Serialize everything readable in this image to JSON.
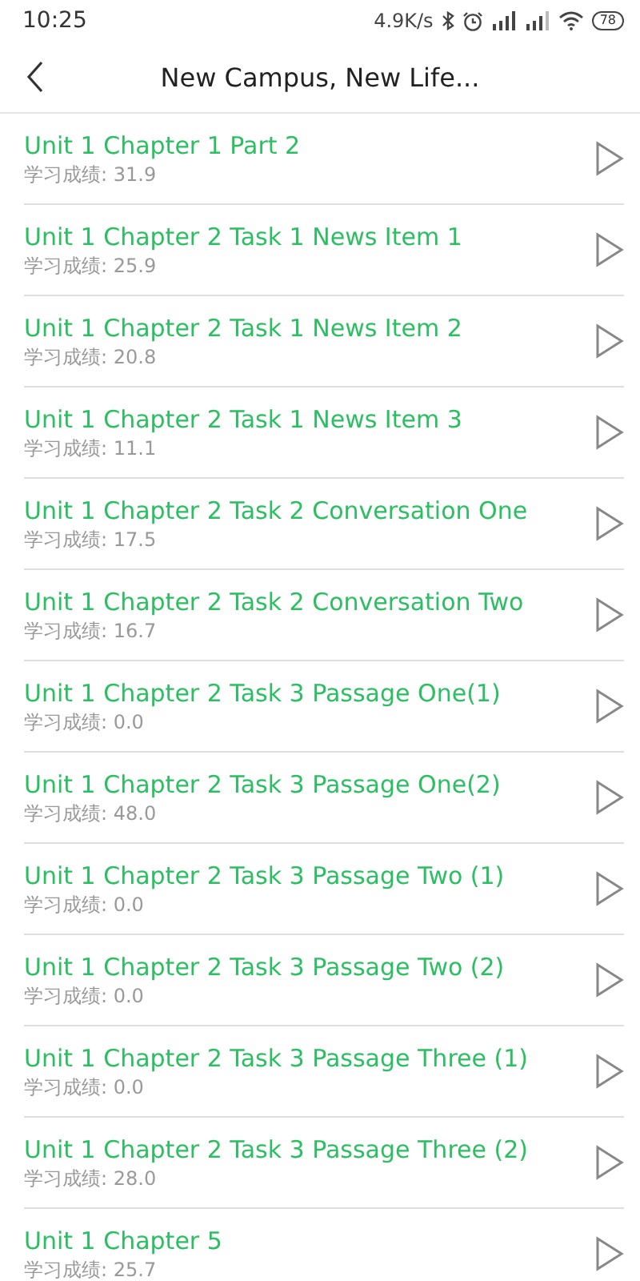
{
  "status_bar": {
    "time": "10:25",
    "speed": "4.9K/s",
    "battery": "78"
  },
  "header": {
    "title": "New Campus, New Life..."
  },
  "items": [
    {
      "title": "Unit 1 Chapter 1 Part 2",
      "score": "学习成绩: 31.9"
    },
    {
      "title": "Unit 1 Chapter 2 Task 1 News Item 1",
      "score": "学习成绩: 25.9"
    },
    {
      "title": "Unit 1 Chapter 2 Task 1 News Item 2",
      "score": "学习成绩: 20.8"
    },
    {
      "title": "Unit 1 Chapter 2 Task 1 News Item 3",
      "score": "学习成绩: 11.1"
    },
    {
      "title": "Unit 1 Chapter 2 Task 2 Conversation One",
      "score": "学习成绩: 17.5"
    },
    {
      "title": "Unit 1 Chapter 2 Task 2 Conversation Two",
      "score": "学习成绩: 16.7"
    },
    {
      "title": "Unit 1 Chapter 2 Task 3 Passage One(1)",
      "score": "学习成绩: 0.0"
    },
    {
      "title": "Unit 1 Chapter 2 Task 3 Passage One(2)",
      "score": "学习成绩: 48.0"
    },
    {
      "title": "Unit 1 Chapter 2 Task 3 Passage Two (1)",
      "score": "学习成绩: 0.0"
    },
    {
      "title": "Unit 1 Chapter 2 Task 3 Passage Two (2)",
      "score": "学习成绩: 0.0"
    },
    {
      "title": "Unit 1 Chapter 2 Task 3 Passage Three (1)",
      "score": "学习成绩: 0.0"
    },
    {
      "title": "Unit 1 Chapter 2 Task 3 Passage Three (2)",
      "score": "学习成绩: 28.0"
    },
    {
      "title": "Unit 1 Chapter 5",
      "score": "学习成绩: 25.7"
    }
  ]
}
